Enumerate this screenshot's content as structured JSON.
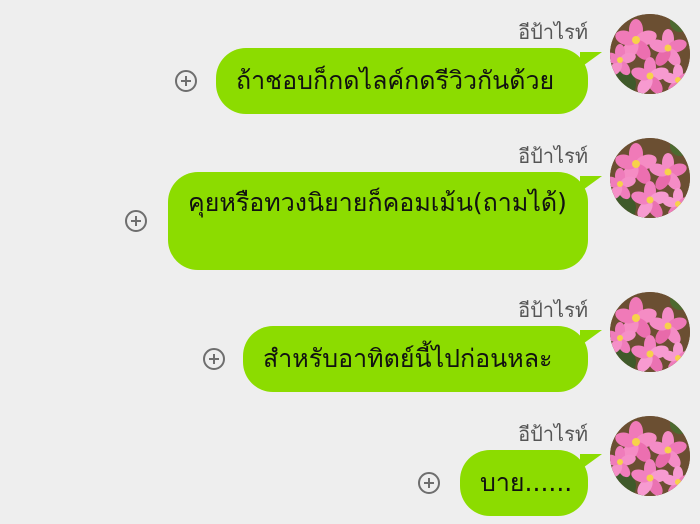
{
  "colors": {
    "background": "#eeeeee",
    "bubble": "#8cdc00",
    "sender_text": "#555555",
    "plus_icon": "#6e6e6e"
  },
  "messages": [
    {
      "sender": "อีป้าไรท์",
      "text": "ถ้าชอบก็กดไลค์กดรีวิวกันด้วย",
      "avatar_icon": "pink-flower-avatar",
      "action_icon": "plus-circle-icon"
    },
    {
      "sender": "อีป้าไรท์",
      "text": "คุยหรือทวงนิยายก็คอมเม้น(ถามได้)",
      "avatar_icon": "pink-flower-avatar",
      "action_icon": "plus-circle-icon"
    },
    {
      "sender": "อีป้าไรท์",
      "text": "สำหรับอาทิตย์นี้ไปก่อนหละ",
      "avatar_icon": "pink-flower-avatar",
      "action_icon": "plus-circle-icon"
    },
    {
      "sender": "อีป้าไรท์",
      "text": "บาย......",
      "avatar_icon": "pink-flower-avatar",
      "action_icon": "plus-circle-icon"
    }
  ]
}
